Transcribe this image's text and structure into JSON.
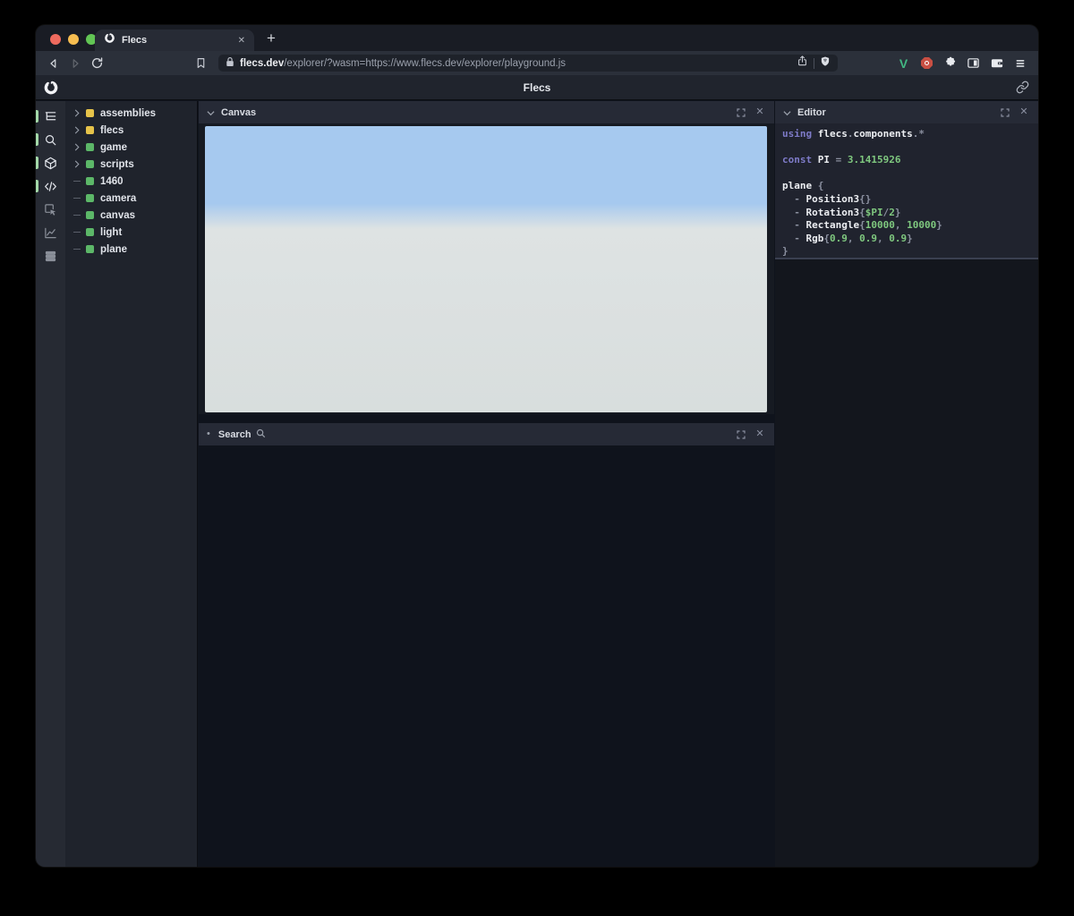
{
  "colors": {
    "accent_green": "#5cb768",
    "accent_yellow": "#e6c34a",
    "active_indicator": "#a3d8a8",
    "traffic_red": "#ee6a5e",
    "traffic_yellow": "#f6bd50",
    "traffic_green": "#62c554",
    "syntax_keyword": "#7e7bc8",
    "syntax_number": "#7fc87f",
    "syntax_punct": "#8b90a0",
    "syntax_identifier": "#eceef2",
    "vue_green": "#42b883",
    "ext_red": "#c94f43",
    "sky": "#a6c9ef",
    "ground": "#d8dedd"
  },
  "glyphs": {
    "close": "✕",
    "plus": "+",
    "bullet": "•"
  },
  "browser": {
    "tab": {
      "title": "Flecs"
    },
    "address": {
      "domain": "flecs.dev",
      "path": "/explorer/?wasm=https://www.flecs.dev/explorer/playground.js"
    },
    "toolbar_icons": [
      "vue-devtools-icon",
      "adblock-icon",
      "extensions-puzzle-icon",
      "sidebar-toggle-icon",
      "wallet-icon",
      "menu-icon"
    ]
  },
  "app": {
    "header_title": "Flecs"
  },
  "sidebar": {
    "items": [
      {
        "name": "tree-icon",
        "active": true
      },
      {
        "name": "search-icon",
        "active": true
      },
      {
        "name": "cube-icon",
        "active": true
      },
      {
        "name": "code-icon",
        "active": true
      },
      {
        "name": "inspect-icon",
        "active": false
      },
      {
        "name": "chart-icon",
        "active": false
      },
      {
        "name": "rows-icon",
        "active": false
      }
    ]
  },
  "tree": {
    "rows": [
      {
        "label": "assemblies",
        "square": "yellow",
        "expandable": true
      },
      {
        "label": "flecs",
        "square": "yellow",
        "expandable": true
      },
      {
        "label": "game",
        "square": "green",
        "expandable": true
      },
      {
        "label": "scripts",
        "square": "green",
        "expandable": true
      },
      {
        "label": "1460",
        "square": "green",
        "expandable": false
      },
      {
        "label": "camera",
        "square": "green",
        "expandable": false
      },
      {
        "label": "canvas",
        "square": "green",
        "expandable": false
      },
      {
        "label": "light",
        "square": "green",
        "expandable": false
      },
      {
        "label": "plane",
        "square": "green",
        "expandable": false
      }
    ]
  },
  "panels": {
    "canvas": {
      "title": "Canvas"
    },
    "search": {
      "title": "Search"
    },
    "editor": {
      "title": "Editor",
      "code_lines": [
        [
          {
            "t": "using ",
            "c": "kw"
          },
          {
            "t": "flecs",
            "c": "id"
          },
          {
            "t": ".",
            "c": "p"
          },
          {
            "t": "components",
            "c": "id"
          },
          {
            "t": ".*",
            "c": "p"
          }
        ],
        [],
        [
          {
            "t": "const ",
            "c": "kw"
          },
          {
            "t": "PI",
            "c": "id"
          },
          {
            "t": " = ",
            "c": "p"
          },
          {
            "t": "3.1415926",
            "c": "num"
          }
        ],
        [],
        [
          {
            "t": "plane",
            "c": "id"
          },
          {
            "t": " {",
            "c": "p"
          }
        ],
        [
          {
            "t": "  - ",
            "c": "p"
          },
          {
            "t": "Position3",
            "c": "id"
          },
          {
            "t": "{}",
            "c": "p"
          }
        ],
        [
          {
            "t": "  - ",
            "c": "p"
          },
          {
            "t": "Rotation3",
            "c": "id"
          },
          {
            "t": "{",
            "c": "p"
          },
          {
            "t": "$PI",
            "c": "num"
          },
          {
            "t": "/",
            "c": "p"
          },
          {
            "t": "2",
            "c": "num"
          },
          {
            "t": "}",
            "c": "p"
          }
        ],
        [
          {
            "t": "  - ",
            "c": "p"
          },
          {
            "t": "Rectangle",
            "c": "id"
          },
          {
            "t": "{",
            "c": "p"
          },
          {
            "t": "10000",
            "c": "num"
          },
          {
            "t": ", ",
            "c": "p"
          },
          {
            "t": "10000",
            "c": "num"
          },
          {
            "t": "}",
            "c": "p"
          }
        ],
        [
          {
            "t": "  - ",
            "c": "p"
          },
          {
            "t": "Rgb",
            "c": "id"
          },
          {
            "t": "{",
            "c": "p"
          },
          {
            "t": "0.9",
            "c": "num"
          },
          {
            "t": ", ",
            "c": "p"
          },
          {
            "t": "0.9",
            "c": "num"
          },
          {
            "t": ", ",
            "c": "p"
          },
          {
            "t": "0.9",
            "c": "num"
          },
          {
            "t": "}",
            "c": "p"
          }
        ],
        [
          {
            "t": "}",
            "c": "p"
          }
        ]
      ]
    }
  }
}
